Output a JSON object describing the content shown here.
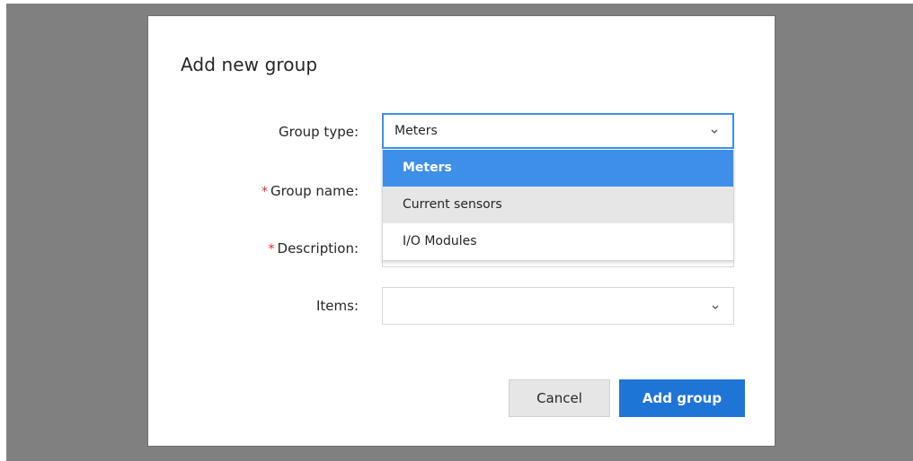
{
  "dialog": {
    "title": "Add new group",
    "fields": {
      "group_type": {
        "label": "Group type:",
        "value": "Meters"
      },
      "group_name": {
        "label": "Group name:",
        "required_mark": "*"
      },
      "description": {
        "label": "Description:",
        "required_mark": "*"
      },
      "items": {
        "label": "Items:",
        "value": ""
      }
    },
    "dropdown": {
      "options": [
        {
          "label": "Meters",
          "state": "selected"
        },
        {
          "label": "Current sensors",
          "state": "hover"
        },
        {
          "label": "I/O Modules",
          "state": "normal"
        }
      ]
    },
    "buttons": {
      "cancel": "Cancel",
      "add": "Add group"
    }
  },
  "colors": {
    "overlay": "#808080",
    "accent": "#3d8fe8",
    "primary_button": "#1f75d6",
    "required": "#e12e2e",
    "hover_option": "#e6e6e6"
  },
  "icons": {
    "select_arrow": "chevron-down-icon"
  }
}
